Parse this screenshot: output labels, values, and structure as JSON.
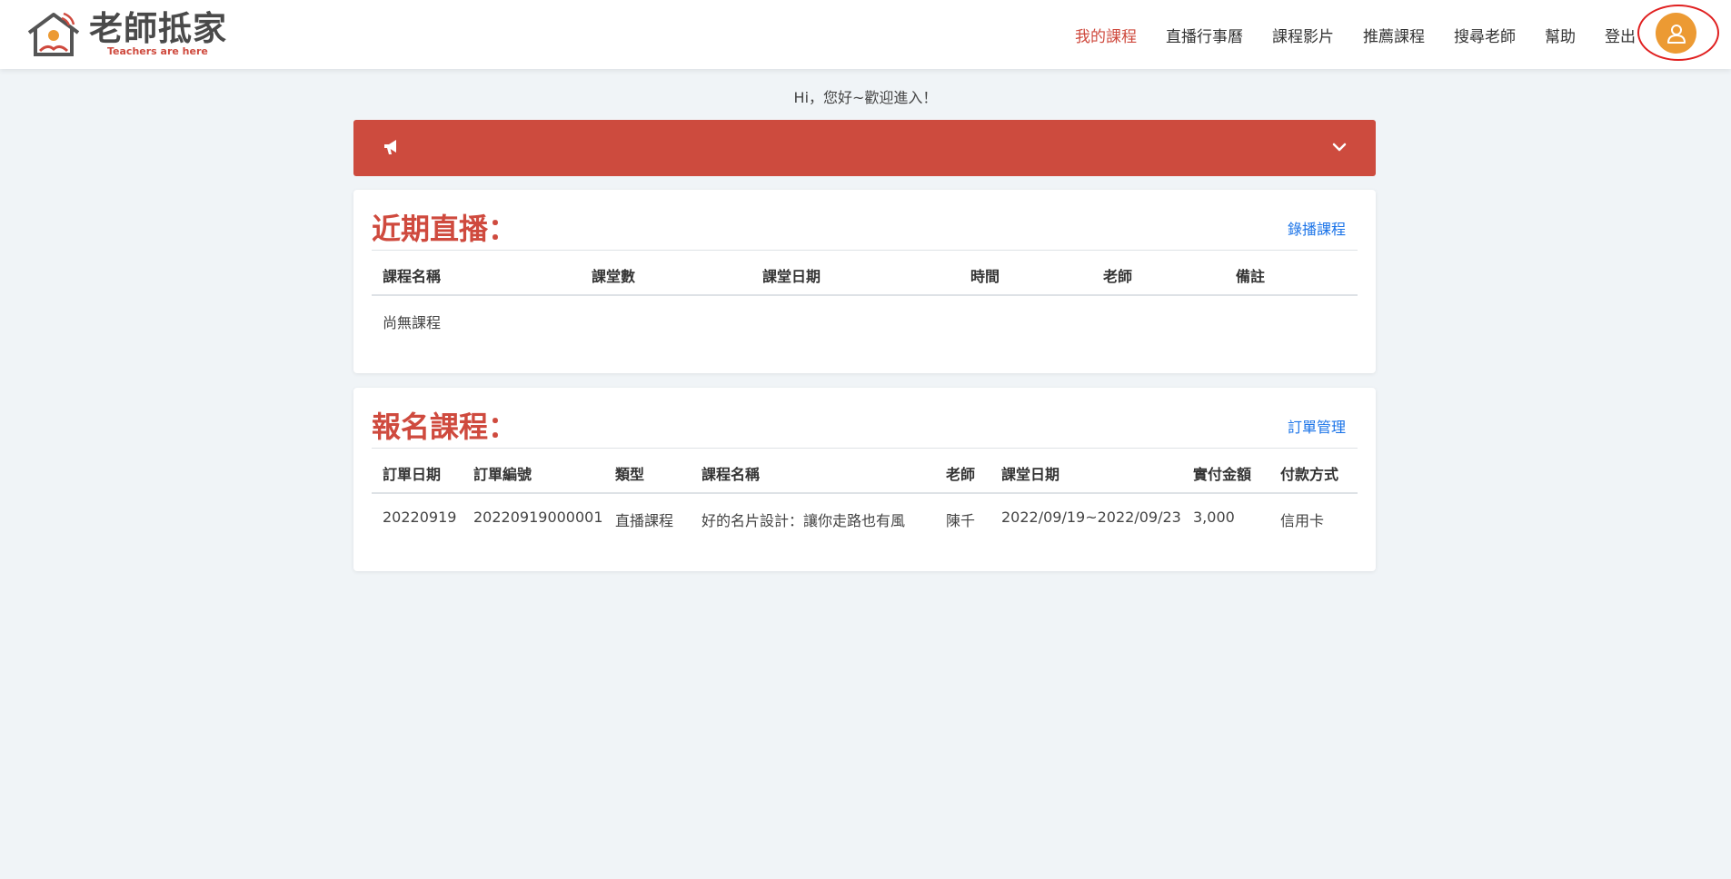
{
  "logo": {
    "title": "老師抵家",
    "subtitle": "Teachers are here"
  },
  "nav": {
    "items": [
      {
        "label": "我的課程"
      },
      {
        "label": "直播行事曆"
      },
      {
        "label": "課程影片"
      },
      {
        "label": "推薦課程"
      },
      {
        "label": "搜尋老師"
      },
      {
        "label": "幫助"
      },
      {
        "label": "登出"
      }
    ],
    "active_index": 0
  },
  "greeting": "Hi，您好~歡迎進入！",
  "banner": {
    "icon": "megaphone-icon",
    "chevron": "chevron-down-icon"
  },
  "live": {
    "title": "近期直播：",
    "link": "錄播課程",
    "headers": [
      "課程名稱",
      "課堂數",
      "課堂日期",
      "時間",
      "老師",
      "備註"
    ],
    "empty_text": "尚無課程"
  },
  "enrolled": {
    "title": "報名課程：",
    "link": "訂單管理",
    "headers": [
      "訂單日期",
      "訂單編號",
      "類型",
      "課程名稱",
      "老師",
      "課堂日期",
      "實付金額",
      "付款方式"
    ],
    "rows": [
      [
        "20220919",
        "20220919000001",
        "直播課程",
        "好的名片設計：讓你走路也有風",
        "陳千",
        "2022/09/19~2022/09/23",
        "3,000",
        "信用卡"
      ]
    ]
  },
  "colors": {
    "accent": "#cf4a3e",
    "link": "#1a73e8",
    "avatar": "#ec9a33",
    "background": "#f0f4f7"
  }
}
